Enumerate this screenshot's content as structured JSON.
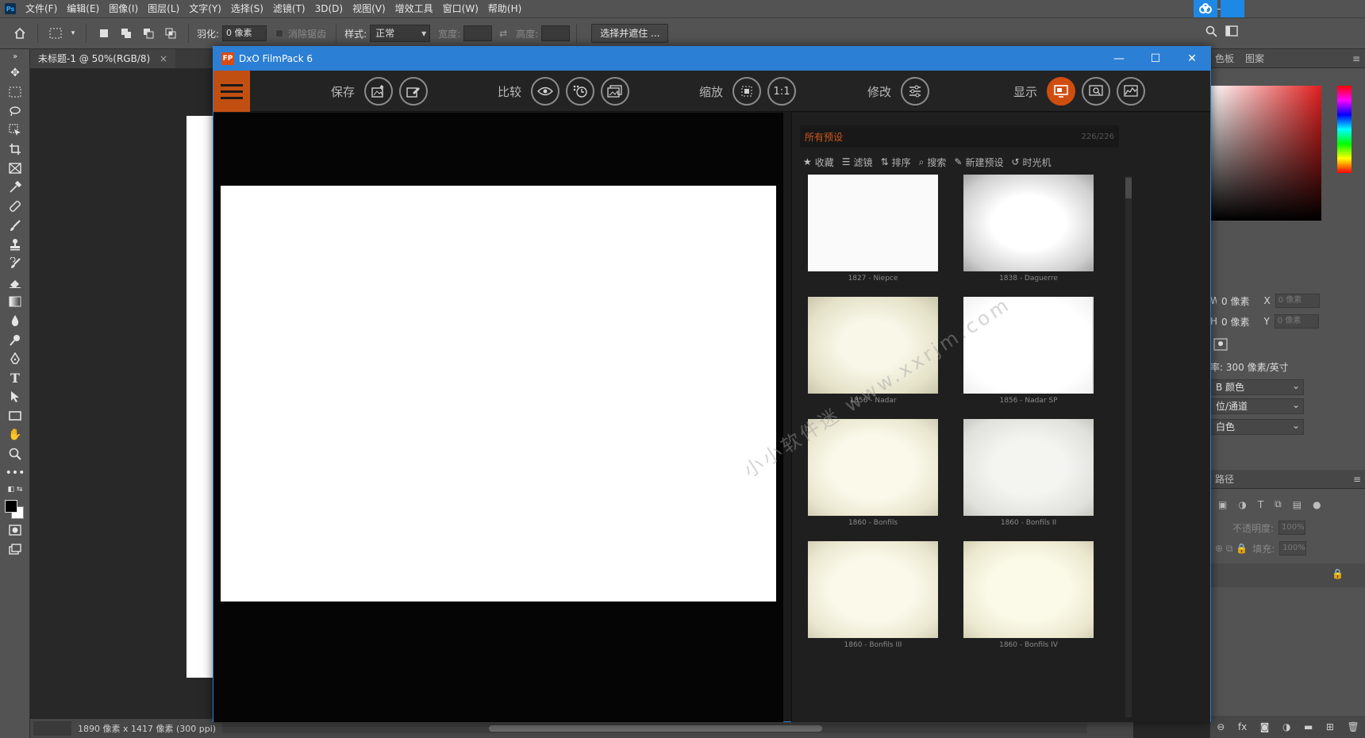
{
  "photoshop": {
    "logo": "Ps",
    "menu": [
      "文件(F)",
      "编辑(E)",
      "图像(I)",
      "图层(L)",
      "文字(Y)",
      "选择(S)",
      "滤镜(T)",
      "3D(D)",
      "视图(V)",
      "增效工具",
      "窗口(W)",
      "帮助(H)"
    ],
    "options": {
      "feather_label": "羽化:",
      "feather_value": "0 像素",
      "antialias_label": "消除锯齿",
      "style_label": "样式:",
      "style_value": "正常",
      "width_label": "宽度:",
      "height_label": "高度:",
      "select_mask_button": "选择并遮住 ..."
    },
    "doc_tab": {
      "label": "未标题-1 @ 50%(RGB/8)",
      "close": "×"
    },
    "status": {
      "doc_info": "1890 像素 x 1417 像素 (300 ppi)",
      "arrow": "›"
    },
    "right_panel": {
      "tab_swatches": "色板",
      "tab_patterns": "图案",
      "w_label": "W",
      "w_value": "0 像素",
      "h_label": "H",
      "h_value": "0 像素",
      "x_label": "X",
      "x_placeholder": "0 像素",
      "y_label": "Y",
      "y_placeholder": "0 像素",
      "resolution": "率: 300 像素/英寸",
      "mode_select": "B 颜色",
      "depth_select": "位/通道",
      "bg_select": "白色",
      "paths_header": "路径",
      "opacity_label": "不透明度:",
      "opacity_value": "100%",
      "fill_label": "填充:",
      "fill_value": "100%"
    }
  },
  "dxo": {
    "app_icon": "FP",
    "title": "DxO FilmPack 6",
    "toolbar": {
      "save_label": "保存",
      "compare_label": "比较",
      "zoom_label": "缩放",
      "zoom_1to1": "1:1",
      "edit_label": "修改",
      "display_label": "显示"
    },
    "presets": {
      "title": "所有预设",
      "count": "226/226",
      "actions": [
        {
          "icon": "★",
          "label": "收藏"
        },
        {
          "icon": "☰",
          "label": "滤镜"
        },
        {
          "icon": "⇅",
          "label": "排序"
        },
        {
          "icon": "⌕",
          "label": "搜索"
        },
        {
          "icon": "✎",
          "label": "新建预设"
        },
        {
          "icon": "↺",
          "label": "时光机"
        }
      ],
      "items": [
        {
          "label": "1827 - Niepce"
        },
        {
          "label": "1838 - Daguerre"
        },
        {
          "label": "1856 - Nadar"
        },
        {
          "label": "1856 - Nadar SP"
        },
        {
          "label": "1860 - Bonfils"
        },
        {
          "label": "1860 - Bonfils II"
        },
        {
          "label": "1860 - Bonfils III"
        },
        {
          "label": "1860 - Bonfils IV"
        }
      ]
    },
    "watermark": "小小软件迷 www.xxrjm.com"
  }
}
